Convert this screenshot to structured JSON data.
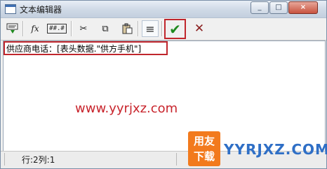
{
  "window": {
    "title": "文本编辑器",
    "controls": {
      "minimize": "_",
      "maximize": "□",
      "close": "×"
    }
  },
  "toolbar": {
    "buttons": [
      {
        "icon": "insert-field-icon"
      },
      {
        "icon": "function-icon",
        "glyph": "fx"
      },
      {
        "icon": "format-icon",
        "glyph": "##.#"
      },
      {
        "icon": "cut-icon",
        "glyph": "✂"
      },
      {
        "icon": "copy-icon",
        "glyph": "⧉"
      },
      {
        "icon": "paste-icon",
        "glyph": "📋"
      },
      {
        "icon": "align-icon",
        "glyph": "≡"
      },
      {
        "icon": "confirm-icon",
        "glyph": "✔"
      },
      {
        "icon": "cancel-icon",
        "glyph": "✕"
      }
    ]
  },
  "editor": {
    "content": "供应商电话：[表头数据.\"供方手机\"]"
  },
  "watermark": {
    "text": "www.yyrjxz.com"
  },
  "status": {
    "position": "行:2列:1"
  },
  "logo": {
    "line1": "用友",
    "line2": "下载",
    "text": "YYRJXZ.COM"
  },
  "colors": {
    "highlight_border": "#c0262c",
    "confirm": "#1f8a1f",
    "cancel": "#8a1f1f",
    "logo_orange": "#f27a1d",
    "logo_blue": "#2f6fc6"
  }
}
